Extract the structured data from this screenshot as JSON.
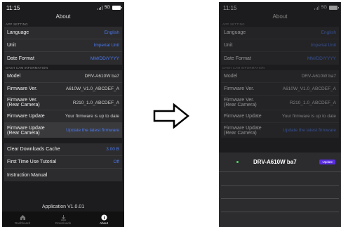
{
  "status": {
    "time": "11:15",
    "network": "5G"
  },
  "page_title": "About",
  "app_setting": {
    "header": "APP SETTING",
    "rows": [
      {
        "label": "Language",
        "value": "English"
      },
      {
        "label": "Unit",
        "value": "Imperial Unit"
      },
      {
        "label": "Date Format",
        "value": "MM/DD/YYYY"
      }
    ]
  },
  "dash_cam_info": {
    "header": "DASH CAM INFORMATION",
    "rows": [
      {
        "label": "Model",
        "value": "DRV-A610W ba7"
      },
      {
        "label": "Firmware Ver.",
        "value": "A610W_V1.0_ABCDEF_A"
      },
      {
        "label": "Firmware Ver.\n(Rear Camera)",
        "value": "R210_1.0_ABCDEF_A"
      },
      {
        "label": "Firmware Update",
        "value": "Your firmware is up to date"
      },
      {
        "label": "Firmware Update\n(Rear Camera)",
        "value": "Update the latest firmware"
      }
    ]
  },
  "misc": {
    "rows": [
      {
        "label": "Clear Downloads Cache",
        "value": "3.00 B"
      },
      {
        "label": "First Time Use Tutorial",
        "value": "Off"
      },
      {
        "label": "Instruction Manual",
        "value": ""
      }
    ]
  },
  "app_version": "Application  V1.0.01",
  "tabs": [
    {
      "label": "Dashboard",
      "icon": "home-icon"
    },
    {
      "label": "Downloads",
      "icon": "download-icon"
    },
    {
      "label": "About",
      "icon": "info-icon"
    }
  ],
  "sheet": {
    "device_name": "DRV-A610W ba7",
    "update_label": "Update"
  },
  "colors": {
    "accent": "#4a78f0",
    "background": "#1c1c1e",
    "update_button": "#5a2de0"
  }
}
